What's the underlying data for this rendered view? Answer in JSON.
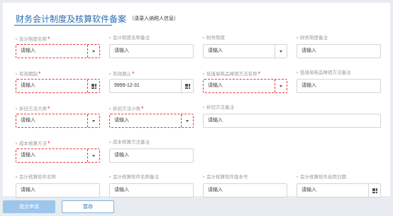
{
  "header": {
    "title": "财务会计制度及核算软件备案",
    "subtitle": "（请录入纳税人信息）"
  },
  "colors": {
    "accent": "#2b6cb0",
    "required": "#e53935"
  },
  "fields": {
    "f1": {
      "label": "会计制度名称",
      "required": true,
      "placeholder": "请输入"
    },
    "f2": {
      "label": "会计制度名称备注",
      "required": false,
      "placeholder": "请输入"
    },
    "f3": {
      "label": "财务制度",
      "required": false,
      "placeholder": "请输入"
    },
    "f4": {
      "label": "财务制度备注",
      "required": false,
      "placeholder": "请输入"
    },
    "f5": {
      "label": "有效期起",
      "required": true,
      "placeholder": "请输入"
    },
    "f6": {
      "label": "有效期止",
      "required": true,
      "value": "9999-12-31"
    },
    "f7": {
      "label": "低值易耗品摊销方法名称",
      "required": true,
      "placeholder": "请输入"
    },
    "f8": {
      "label": "低值易耗品摊销方法备注",
      "required": false,
      "placeholder": "请输入"
    },
    "f9": {
      "label": "折旧方法大类",
      "required": true,
      "placeholder": "请输入"
    },
    "f10": {
      "label": "折旧方法小类",
      "required": true,
      "placeholder": "请输入"
    },
    "f11": {
      "label": "折旧方法备注",
      "required": false,
      "placeholder": "请输入"
    },
    "f12": {
      "label": "成本核算方法",
      "required": true,
      "placeholder": "请输入"
    },
    "f13": {
      "label": "成本核算方法备注",
      "required": false,
      "placeholder": "请输入"
    },
    "f14": {
      "label": "会计核算软件名称",
      "required": false,
      "placeholder": "请输入"
    },
    "f15": {
      "label": "会计核算软件名称备注",
      "required": false,
      "placeholder": "请输入"
    },
    "f16": {
      "label": "会计核算软件版本号",
      "required": false,
      "placeholder": "请输入"
    },
    "f17": {
      "label": "会计核算软件启用日期",
      "required": false,
      "placeholder": "请输入"
    }
  },
  "required_mark": "*",
  "buttons": {
    "submit": "提交申请",
    "save": "暂存"
  }
}
